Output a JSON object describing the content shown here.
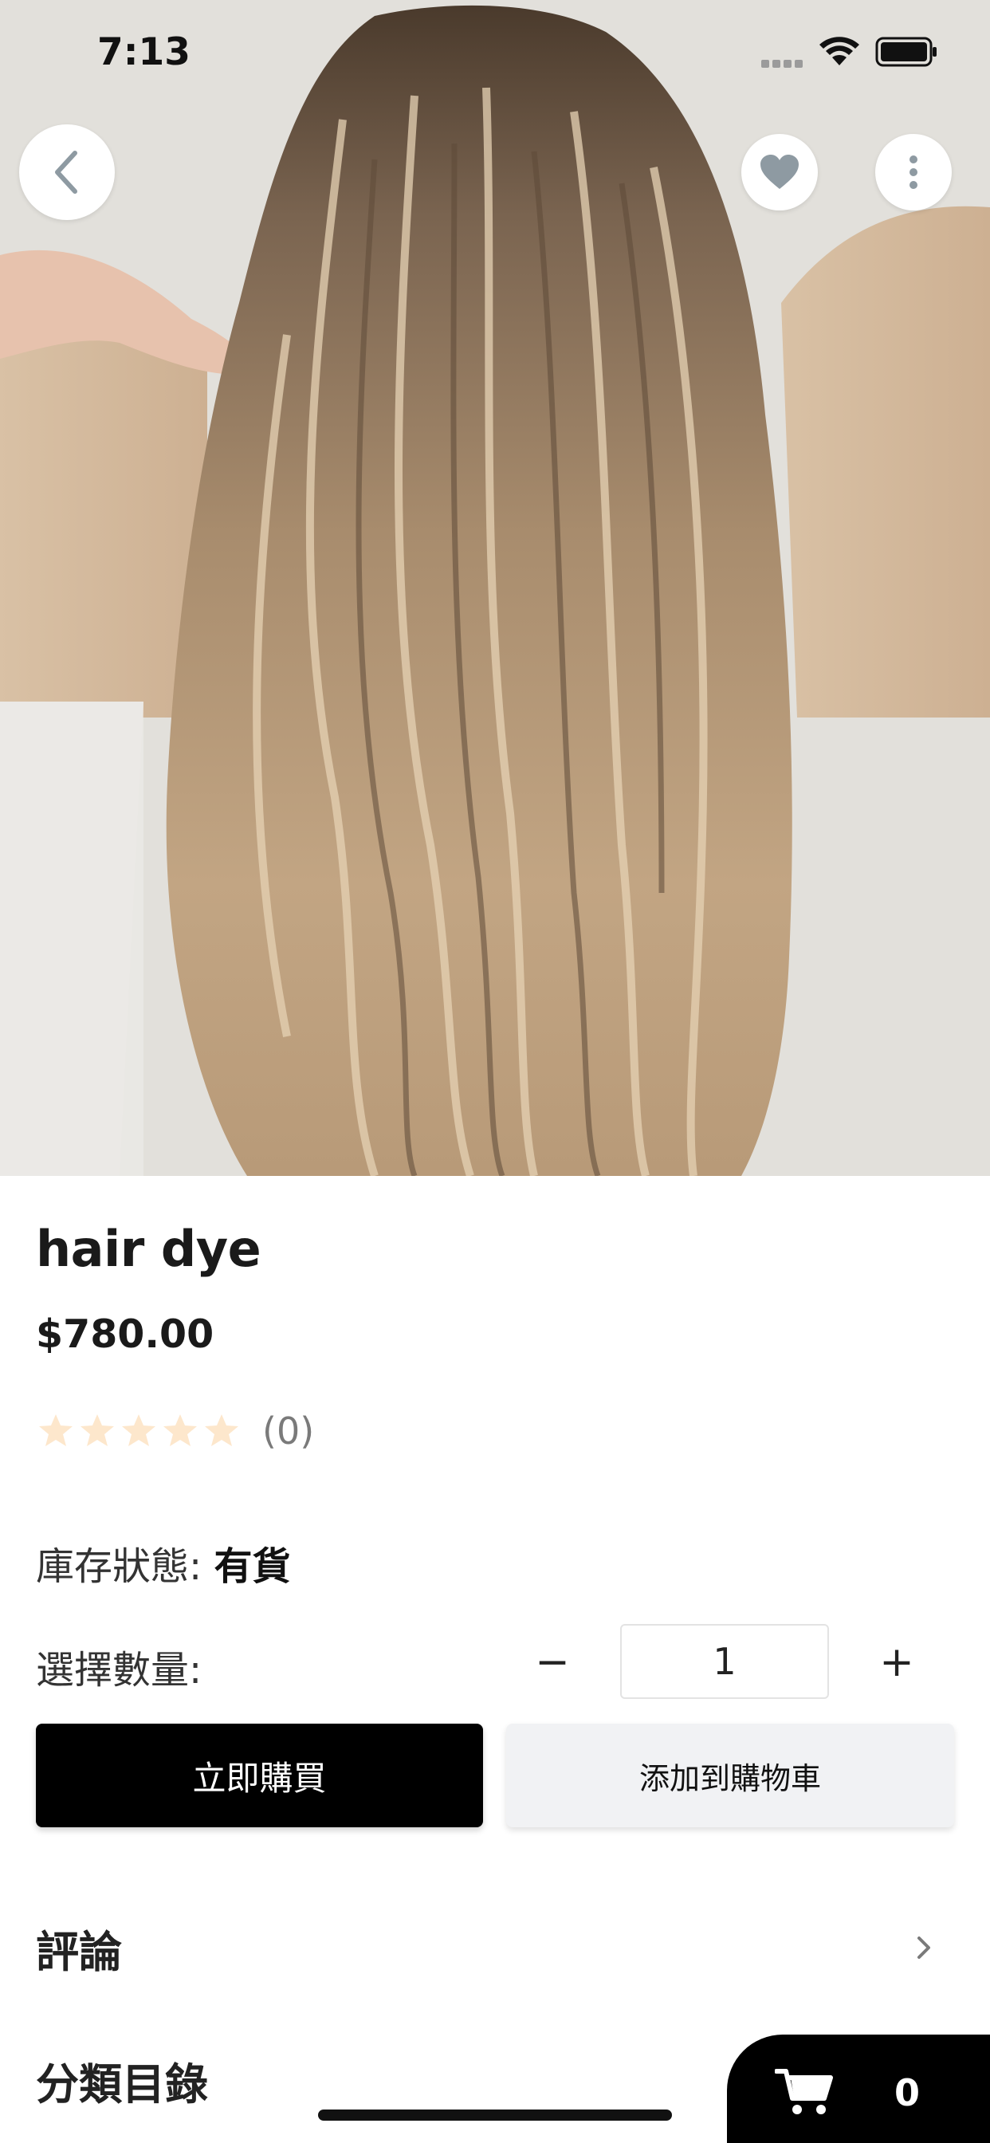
{
  "status_bar": {
    "time": "7:13"
  },
  "nav": {
    "back_icon": "chevron-left-icon",
    "favorite_icon": "heart-icon",
    "more_icon": "more-vertical-icon"
  },
  "product": {
    "title": "hair dye",
    "price": "$780.00",
    "rating": 0,
    "rating_max": 5,
    "rating_count": "(0)",
    "stock_label": "庫存狀態:",
    "stock_value": "有貨",
    "quantity_label": "選擇數量:",
    "quantity_value": "1",
    "quantity_minus": "−",
    "quantity_plus": "+"
  },
  "actions": {
    "buy_now": "立即購買",
    "add_to_cart": "添加到購物車"
  },
  "sections": {
    "reviews": "評論",
    "category": "分類目錄"
  },
  "cart": {
    "count": "0"
  },
  "colors": {
    "star_empty": "#fde7cc",
    "primary_button": "#000000",
    "secondary_button": "#f1f2f4",
    "favorite_icon": "#8e9aa2"
  }
}
